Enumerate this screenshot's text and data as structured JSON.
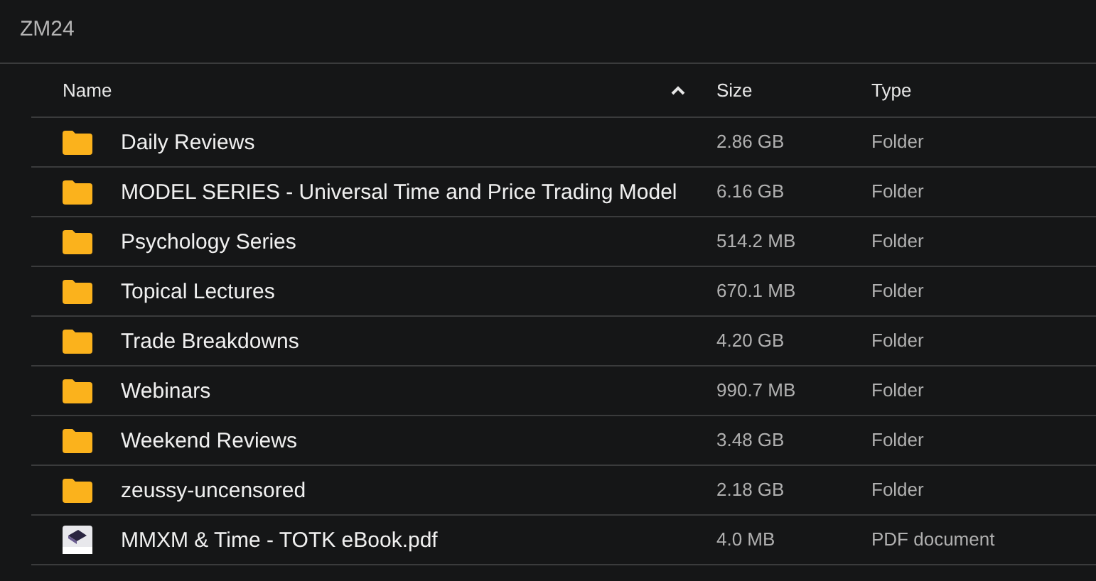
{
  "title": "ZM24",
  "columns": [
    {
      "label": "Name",
      "sorted": true
    },
    {
      "label": "Size",
      "sorted": false
    },
    {
      "label": "Type",
      "sorted": false
    }
  ],
  "rows": [
    {
      "kind": "folder",
      "name": "Daily Reviews",
      "size": "2.86 GB",
      "type": "Folder"
    },
    {
      "kind": "folder",
      "name": "MODEL SERIES - Universal Time and Price Trading Model",
      "size": "6.16 GB",
      "type": "Folder"
    },
    {
      "kind": "folder",
      "name": "Psychology Series",
      "size": "514.2 MB",
      "type": "Folder"
    },
    {
      "kind": "folder",
      "name": "Topical Lectures",
      "size": "670.1 MB",
      "type": "Folder"
    },
    {
      "kind": "folder",
      "name": "Trade Breakdowns",
      "size": "4.20 GB",
      "type": "Folder"
    },
    {
      "kind": "folder",
      "name": "Webinars",
      "size": "990.7 MB",
      "type": "Folder"
    },
    {
      "kind": "folder",
      "name": "Weekend Reviews",
      "size": "3.48 GB",
      "type": "Folder"
    },
    {
      "kind": "folder",
      "name": "zeussy-uncensored",
      "size": "2.18 GB",
      "type": "Folder"
    },
    {
      "kind": "pdf",
      "name": "MMXM & Time - TOTK eBook.pdf",
      "size": "4.0 MB",
      "type": "PDF document"
    }
  ]
}
